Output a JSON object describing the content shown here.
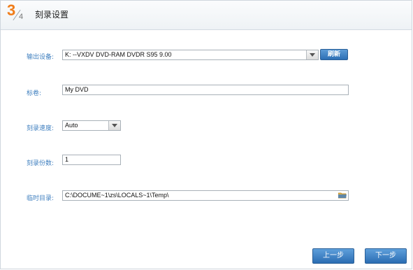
{
  "header": {
    "step_current": "3",
    "step_total": "4",
    "title": "刻录设置"
  },
  "form": {
    "output_device": {
      "label": "输出设备:",
      "value": "K:  --VXDV    DVD-RAM DVDR S95 9.00",
      "refresh_label": "刷新"
    },
    "volume_label": {
      "label": "标卷:",
      "value": "My DVD"
    },
    "burn_speed": {
      "label": "刻录速度:",
      "value": "Auto"
    },
    "copies": {
      "label": "刻录份数:",
      "value": "1"
    },
    "temp_dir": {
      "label": "临时目录:",
      "value": "C:\\DOCUME~1\\zs\\LOCALS~1\\Temp\\"
    }
  },
  "footer": {
    "prev_label": "上一步",
    "next_label": "下一步"
  },
  "colors": {
    "accent": "#f07d1a",
    "label": "#3f7fbf",
    "button": "#2c6fb5"
  }
}
